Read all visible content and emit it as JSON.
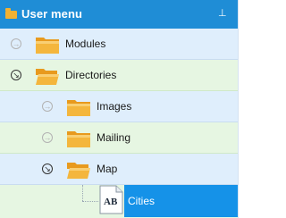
{
  "header": {
    "title": "User menu",
    "header_icon": "folder-icon",
    "pin_icon": "pin-icon",
    "pin_glyph": "⊥"
  },
  "tree": {
    "collapsed_glyph": "→",
    "expanded_glyph": "↘",
    "items": [
      {
        "label": "Modules",
        "icon": "folder-closed-icon",
        "state": "collapsed"
      },
      {
        "label": "Directories",
        "icon": "folder-open-icon",
        "state": "expanded"
      },
      {
        "label": "Images",
        "icon": "folder-closed-icon",
        "state": "collapsed"
      },
      {
        "label": "Mailing",
        "icon": "folder-closed-icon",
        "state": "collapsed"
      },
      {
        "label": "Map",
        "icon": "folder-open-icon",
        "state": "expanded"
      },
      {
        "label": "Cities",
        "icon": "document-ab-icon",
        "state": "selected",
        "icon_text": "AB"
      }
    ]
  },
  "colors": {
    "header_bg": "#1f8dd6",
    "row_blue": "#dfeefc",
    "row_green": "#e6f6e2",
    "selected_bg": "#1592e8",
    "folder": "#f2b132"
  }
}
